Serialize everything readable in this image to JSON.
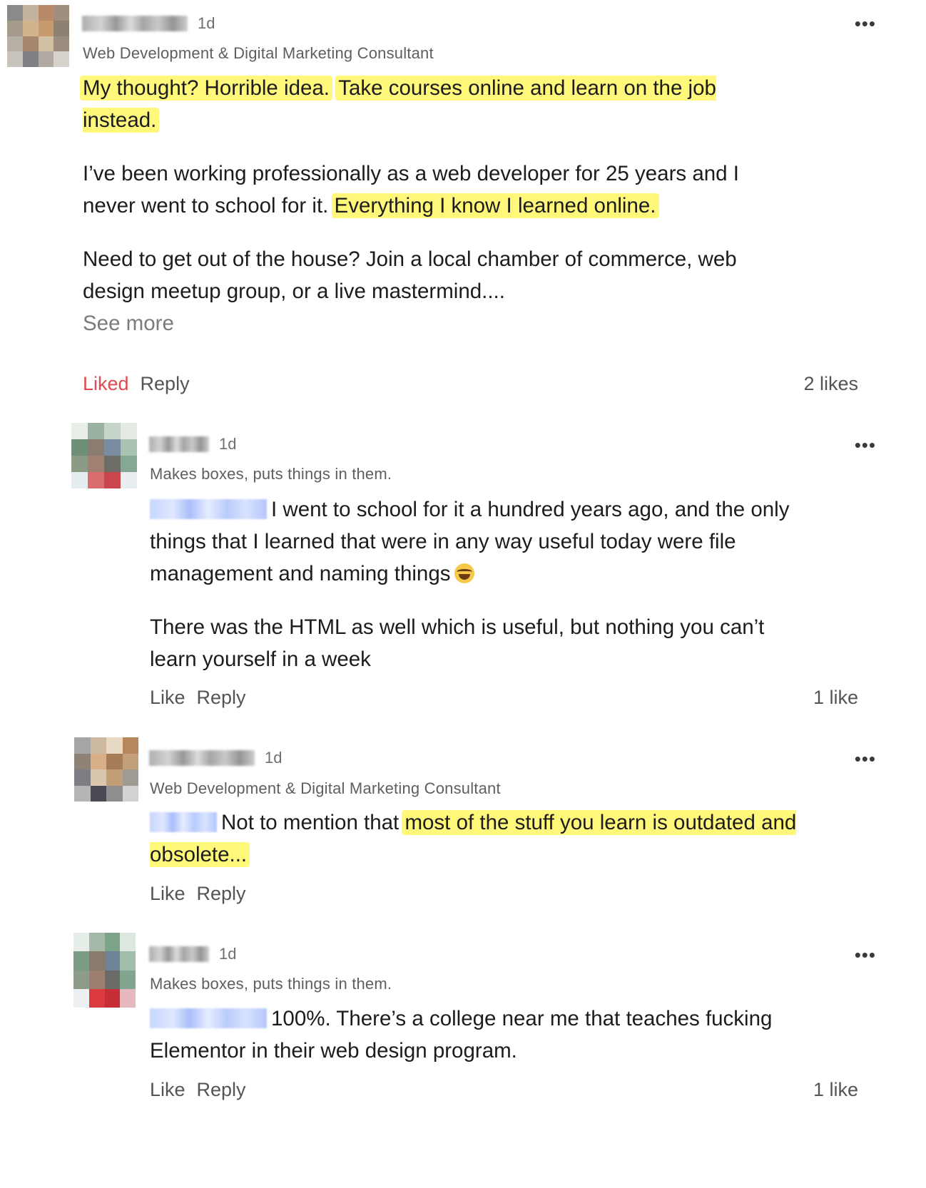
{
  "comments": [
    {
      "time": "1d",
      "headline": "Web Development & Digital Marketing Consultant",
      "more_label": "•••",
      "paragraphs": [
        [
          "",
          "My thought? Horrible idea.",
          " ",
          "Take courses online and learn on the job instead."
        ],
        [
          "I’ve been working professionally as a web developer for 25 years and I never went to school for it. ",
          "Everything I know I learned online."
        ],
        [
          "Need to get out of the house? Join a local chamber of commerce, web design meetup group, or a live mastermind...."
        ]
      ],
      "see_more": "See more",
      "like_label": "Liked",
      "reply_label": "Reply",
      "likes": "2 likes",
      "avatar_colors": [
        "#8a8a8a",
        "#c4b39f",
        "#b88a6a",
        "#9f8f7e",
        "#a59a8b",
        "#d1b38e",
        "#c79a6f",
        "#8c8073",
        "#b7b0a5",
        "#a4876d",
        "#d2c0a5",
        "#9a8d7f",
        "#c8c3bd",
        "#7f7f86",
        "#b0aaa3",
        "#d7d2cc"
      ],
      "accent": "#e0494f"
    },
    {
      "time": "1d",
      "headline": "Makes boxes, puts things in them.",
      "more_label": "•••",
      "paragraphs": [
        [
          "I went to school for it a hundred years ago, and the only things that I learned that were in any way useful today were file management and naming things"
        ],
        [
          "There was the HTML as well which is useful, but nothing you can’t learn yourself in a week"
        ]
      ],
      "emoji": "face-with-tears-of-joy",
      "like_label": "Like",
      "reply_label": "Reply",
      "likes": "1 like",
      "avatar_colors": [
        "#e8efe8",
        "#9ab2a0",
        "#c6d5c8",
        "#e3ebe4",
        "#6f8f79",
        "#8b7b70",
        "#7a8da0",
        "#a9c3b2",
        "#8c9a86",
        "#a08171",
        "#6d6e68",
        "#86a892",
        "#e5ecf0",
        "#d96c6f",
        "#c9464d",
        "#e9eef0"
      ]
    },
    {
      "time": "1d",
      "headline": "Web Development & Digital Marketing Consultant",
      "more_label": "•••",
      "paragraphs": [
        [
          "Not to mention that ",
          "most of the stuff you learn is outdated and obsolete..."
        ]
      ],
      "like_label": "Like",
      "reply_label": "Reply",
      "likes": "",
      "avatar_colors": [
        "#a6a6a6",
        "#cdb8a0",
        "#e8d9c5",
        "#b8865c",
        "#8e8277",
        "#d7b08a",
        "#a77c58",
        "#c4a07a",
        "#7d7d84",
        "#d9c6ad",
        "#c29e77",
        "#9f9a92",
        "#b5b5b5",
        "#4a4a55",
        "#8e8e8e",
        "#d2d2d2"
      ]
    },
    {
      "time": "1d",
      "headline": "Makes boxes, puts things in them.",
      "more_label": "•••",
      "paragraphs": [
        [
          "100%. There’s a college near me that teaches fucking Elementor in their web design program."
        ]
      ],
      "like_label": "Like",
      "reply_label": "Reply",
      "likes": "1 like",
      "avatar_colors": [
        "#e7ede8",
        "#a4b9a8",
        "#7ea38b",
        "#dfe7e1",
        "#7b9b84",
        "#8a7a6e",
        "#6f8396",
        "#9fbfa9",
        "#8d9c88",
        "#9d7f70",
        "#6b6c67",
        "#82a58e",
        "#ecf0f2",
        "#d9393f",
        "#c72d36",
        "#e6b9bd"
      ]
    }
  ]
}
